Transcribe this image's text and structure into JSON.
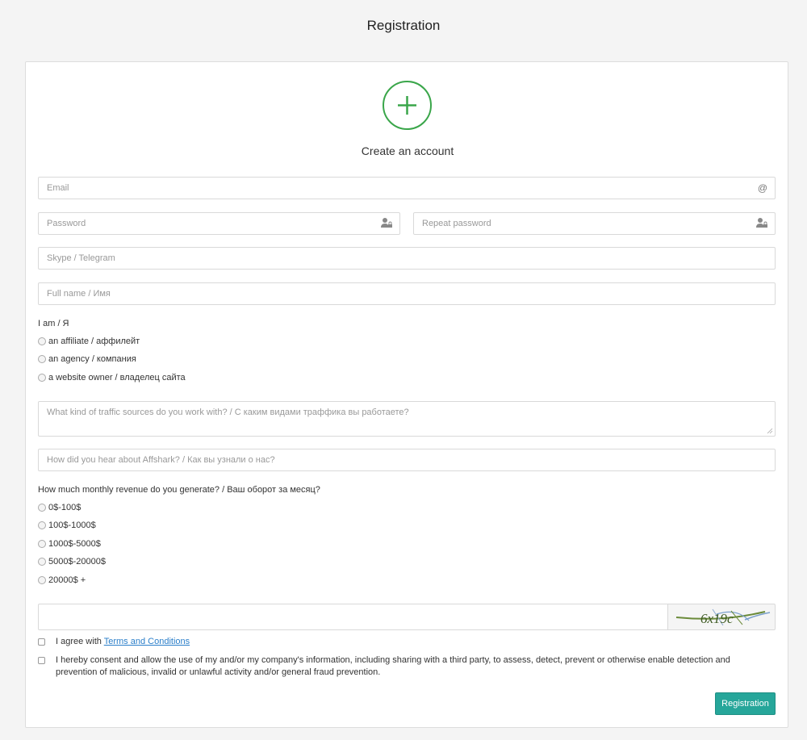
{
  "page_title": "Registration",
  "header": {
    "icon": "plus-circle-icon",
    "subtitle": "Create an account",
    "accent_color": "#3aa64a"
  },
  "fields": {
    "email": {
      "placeholder": "Email",
      "value": "",
      "icon": "at-sign-icon",
      "icon_glyph": "@"
    },
    "password": {
      "placeholder": "Password",
      "value": "",
      "icon": "user-lock-icon"
    },
    "repeat_password": {
      "placeholder": "Repeat password",
      "value": "",
      "icon": "user-lock-icon"
    },
    "messenger": {
      "placeholder": "Skype / Telegram",
      "value": ""
    },
    "full_name": {
      "placeholder": "Full name / Имя",
      "value": ""
    },
    "traffic_sources": {
      "placeholder": "What kind of traffic sources do you work with? / С каким видами траффика вы работаете?",
      "value": ""
    },
    "referral_source": {
      "placeholder": "How did you hear about Affshark? / Как вы узнали о нас?",
      "value": ""
    },
    "captcha": {
      "value": "",
      "image_text": "6x19c"
    }
  },
  "role": {
    "label": "I am / Я",
    "options": [
      "an affiliate / аффилейт",
      "an agency / компания",
      "a website owner / владелец сайта"
    ],
    "selected": null
  },
  "revenue": {
    "label": "How much monthly revenue do you generate? / Ваш оборот за месяц?",
    "options": [
      "0$-100$",
      "100$-1000$",
      "1000$-5000$",
      "5000$-20000$",
      "20000$ +"
    ],
    "selected": null
  },
  "agreements": {
    "terms_prefix": "I agree with ",
    "terms_link": "Terms and Conditions",
    "terms_checked": false,
    "consent_text": "I hereby consent and allow the use of my and/or my company's information, including sharing with a third party, to assess, detect, prevent or otherwise enable detection and prevention of malicious, invalid or unlawful activity and/or general fraud prevention.",
    "consent_checked": false
  },
  "submit": {
    "label": "Registration",
    "color": "#26a69a"
  }
}
